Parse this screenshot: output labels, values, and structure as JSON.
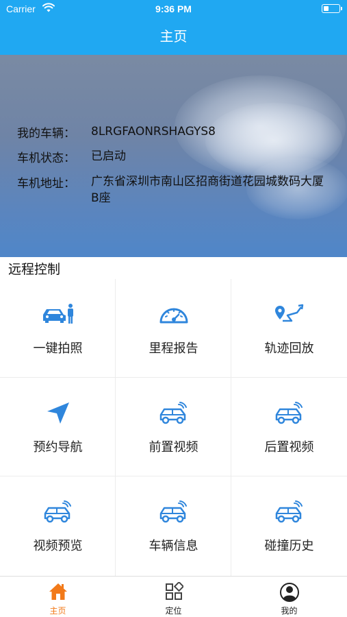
{
  "status_bar": {
    "carrier": "Carrier",
    "time": "9:36 PM"
  },
  "nav": {
    "title": "主页"
  },
  "vehicle": {
    "my_vehicle_label": "我的车辆：",
    "my_vehicle_value": "8LRGFAONRSHAGYS8",
    "status_label": "车机状态：",
    "status_value": "已启动",
    "address_label": "车机地址：",
    "address_value": "广东省深圳市南山区招商街道花园城数码大厦B座"
  },
  "remote": {
    "title": "远程控制",
    "items": [
      {
        "label": "一键拍照",
        "icon": "car-person-icon"
      },
      {
        "label": "里程报告",
        "icon": "speedometer-icon"
      },
      {
        "label": "轨迹回放",
        "icon": "route-icon"
      },
      {
        "label": "预约导航",
        "icon": "navigation-arrow-icon"
      },
      {
        "label": "前置视频",
        "icon": "car-signal-icon"
      },
      {
        "label": "后置视频",
        "icon": "car-signal-icon"
      },
      {
        "label": "视频预览",
        "icon": "car-signal-icon"
      },
      {
        "label": "车辆信息",
        "icon": "car-signal-icon"
      },
      {
        "label": "碰撞历史",
        "icon": "car-signal-icon"
      }
    ]
  },
  "tabs": [
    {
      "label": "主页",
      "icon": "home-icon",
      "active": true
    },
    {
      "label": "定位",
      "icon": "grid-icon",
      "active": false
    },
    {
      "label": "我的",
      "icon": "profile-icon",
      "active": false
    }
  ],
  "colors": {
    "primary": "#20a8f2",
    "icon_blue": "#2f86dc",
    "tab_active": "#f27a1a"
  }
}
